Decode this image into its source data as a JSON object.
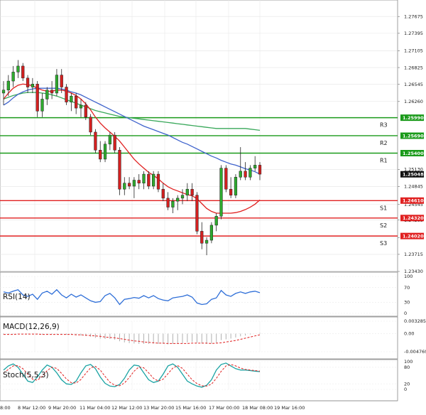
{
  "chart_data": {
    "type": "candlestick",
    "x_labels": [
      "8:00",
      "8 Mar 12:00",
      "9 Mar 20:00",
      "11 Mar 04:00",
      "12 Mar 12:00",
      "13 Mar 20:00",
      "15 Mar 16:00",
      "17 Mar 00:00",
      "18 Mar 08:00",
      "19 Mar 16:00"
    ],
    "y_ticks": [
      "1.27675",
      "1.27395",
      "1.27105",
      "1.26825",
      "1.26545",
      "1.26260",
      "1.25130",
      "1.24845",
      "1.24545",
      "1.24285",
      "1.23995",
      "1.23715",
      "1.23430"
    ],
    "ylim": [
      1.2343,
      1.27855
    ],
    "current_price": "1.25048",
    "colors": {
      "bull": "#2eaa2e",
      "bear": "#d42020",
      "ma_fast": "#e02020",
      "ma_mid": "#3f63cc",
      "ma_slow": "#39a85a",
      "resistance": "#1a9a1a",
      "support": "#e02020"
    },
    "levels": [
      {
        "name": "R3",
        "value": 1.2599,
        "label": "1.25990",
        "kind": "resistance"
      },
      {
        "name": "R2",
        "value": 1.2569,
        "label": "1.25690",
        "kind": "resistance"
      },
      {
        "name": "R1",
        "value": 1.254,
        "label": "1.25400",
        "kind": "resistance"
      },
      {
        "name": "S1",
        "value": 1.2461,
        "label": "1.24610",
        "kind": "support"
      },
      {
        "name": "S2",
        "value": 1.2432,
        "label": "1.24320",
        "kind": "support"
      },
      {
        "name": "S3",
        "value": 1.2402,
        "label": "1.24020",
        "kind": "support"
      }
    ],
    "candles": [
      [
        1.264,
        1.266,
        1.262,
        1.2645
      ],
      [
        1.2645,
        1.267,
        1.2635,
        1.266
      ],
      [
        1.266,
        1.2685,
        1.265,
        1.2675
      ],
      [
        1.2675,
        1.2695,
        1.2665,
        1.2685
      ],
      [
        1.2685,
        1.269,
        1.266,
        1.2665
      ],
      [
        1.2665,
        1.267,
        1.264,
        1.265
      ],
      [
        1.265,
        1.2665,
        1.264,
        1.2655
      ],
      [
        1.2655,
        1.266,
        1.26,
        1.261
      ],
      [
        1.261,
        1.264,
        1.26,
        1.263
      ],
      [
        1.263,
        1.265,
        1.262,
        1.2645
      ],
      [
        1.2645,
        1.266,
        1.263,
        1.264
      ],
      [
        1.264,
        1.268,
        1.2635,
        1.267
      ],
      [
        1.267,
        1.268,
        1.264,
        1.265
      ],
      [
        1.265,
        1.2655,
        1.262,
        1.2625
      ],
      [
        1.2625,
        1.264,
        1.261,
        1.2635
      ],
      [
        1.2635,
        1.264,
        1.2605,
        1.2615
      ],
      [
        1.2615,
        1.263,
        1.26,
        1.262
      ],
      [
        1.262,
        1.2625,
        1.2595,
        1.26
      ],
      [
        1.26,
        1.2605,
        1.257,
        1.2575
      ],
      [
        1.2575,
        1.258,
        1.254,
        1.2545
      ],
      [
        1.2545,
        1.256,
        1.2525,
        1.253
      ],
      [
        1.253,
        1.256,
        1.2525,
        1.2555
      ],
      [
        1.2555,
        1.2575,
        1.2545,
        1.257
      ],
      [
        1.257,
        1.2575,
        1.254,
        1.2545
      ],
      [
        1.2545,
        1.255,
        1.247,
        1.248
      ],
      [
        1.248,
        1.25,
        1.247,
        1.249
      ],
      [
        1.249,
        1.25,
        1.248,
        1.2485
      ],
      [
        1.2485,
        1.25,
        1.2465,
        1.2495
      ],
      [
        1.2495,
        1.2505,
        1.248,
        1.249
      ],
      [
        1.249,
        1.251,
        1.248,
        1.2505
      ],
      [
        1.2505,
        1.251,
        1.248,
        1.2485
      ],
      [
        1.2485,
        1.251,
        1.248,
        1.2505
      ],
      [
        1.2505,
        1.251,
        1.2475,
        1.248
      ],
      [
        1.248,
        1.249,
        1.246,
        1.2465
      ],
      [
        1.2465,
        1.2475,
        1.2445,
        1.245
      ],
      [
        1.245,
        1.2465,
        1.244,
        1.246
      ],
      [
        1.246,
        1.247,
        1.2445,
        1.2465
      ],
      [
        1.2465,
        1.248,
        1.2455,
        1.247
      ],
      [
        1.247,
        1.249,
        1.246,
        1.248
      ],
      [
        1.248,
        1.249,
        1.246,
        1.247
      ],
      [
        1.247,
        1.2475,
        1.2405,
        1.241
      ],
      [
        1.241,
        1.2425,
        1.238,
        1.239
      ],
      [
        1.239,
        1.24,
        1.237,
        1.2395
      ],
      [
        1.2395,
        1.2425,
        1.239,
        1.242
      ],
      [
        1.242,
        1.244,
        1.241,
        1.2435
      ],
      [
        1.2435,
        1.252,
        1.243,
        1.2515
      ],
      [
        1.2515,
        1.252,
        1.2475,
        1.248
      ],
      [
        1.248,
        1.25,
        1.2465,
        1.247
      ],
      [
        1.247,
        1.2505,
        1.2465,
        1.25
      ],
      [
        1.25,
        1.255,
        1.2495,
        1.251
      ],
      [
        1.251,
        1.2525,
        1.2495,
        1.25
      ],
      [
        1.25,
        1.252,
        1.2495,
        1.2515
      ],
      [
        1.2515,
        1.2535,
        1.251,
        1.252
      ],
      [
        1.252,
        1.2525,
        1.2495,
        1.2505
      ]
    ],
    "ma_fast": [
      1.263,
      1.264,
      1.2648,
      1.2653,
      1.2655,
      1.2654,
      1.2652,
      1.2648,
      1.2645,
      1.2643,
      1.2643,
      1.2645,
      1.2645,
      1.2643,
      1.264,
      1.2636,
      1.263,
      1.2622,
      1.2612,
      1.26,
      1.259,
      1.2582,
      1.2575,
      1.2568,
      1.256,
      1.255,
      1.254,
      1.253,
      1.2522,
      1.2515,
      1.2508,
      1.2503,
      1.2497,
      1.249,
      1.2484,
      1.248,
      1.2477,
      1.2474,
      1.2471,
      1.2469,
      1.2464,
      1.2456,
      1.2448,
      1.2443,
      1.244,
      1.244,
      1.244,
      1.244,
      1.2441,
      1.2443,
      1.2446,
      1.245,
      1.2455,
      1.2462
    ],
    "ma_mid": [
      1.262,
      1.2625,
      1.2632,
      1.2638,
      1.2642,
      1.2645,
      1.2647,
      1.2648,
      1.2648,
      1.2648,
      1.2648,
      1.2648,
      1.2647,
      1.2645,
      1.2642,
      1.264,
      1.2637,
      1.2633,
      1.2629,
      1.2625,
      1.2621,
      1.2617,
      1.2613,
      1.2609,
      1.2605,
      1.2601,
      1.2597,
      1.2593,
      1.2589,
      1.2585,
      1.2582,
      1.2579,
      1.2576,
      1.2573,
      1.257,
      1.2566,
      1.2562,
      1.2558,
      1.2555,
      1.2551,
      1.2547,
      1.2543,
      1.2539,
      1.2535,
      1.2532,
      1.2528,
      1.2525,
      1.2522,
      1.252,
      1.2517,
      1.2514,
      1.2512,
      1.2509,
      1.2505
    ],
    "ma_slow": [
      1.263,
      1.2633,
      1.2636,
      1.2638,
      1.264,
      1.2641,
      1.2641,
      1.2641,
      1.264,
      1.2639,
      1.2637,
      1.2635,
      1.2632,
      1.2629,
      1.2626,
      1.2623,
      1.262,
      1.2617,
      1.2614,
      1.2611,
      1.2609,
      1.2607,
      1.2605,
      1.2603,
      1.2601,
      1.26,
      1.2599,
      1.2598,
      1.2597,
      1.2596,
      1.2595,
      1.2594,
      1.2593,
      1.2592,
      1.2591,
      1.259,
      1.2589,
      1.2588,
      1.2587,
      1.2586,
      1.2585,
      1.2584,
      1.2583,
      1.2582,
      1.2581,
      1.2581,
      1.2581,
      1.2581,
      1.2581,
      1.2581,
      1.2581,
      1.258,
      1.2579,
      1.2578
    ],
    "rsi": {
      "label": "RSI(14)",
      "ticks": [
        "100",
        "70",
        "30",
        "0"
      ],
      "ylim": [
        0,
        100
      ],
      "values": [
        58,
        55,
        60,
        64,
        50,
        46,
        52,
        38,
        55,
        60,
        52,
        64,
        50,
        42,
        52,
        44,
        50,
        42,
        34,
        30,
        32,
        48,
        54,
        42,
        24,
        38,
        40,
        43,
        41,
        48,
        42,
        48,
        40,
        36,
        34,
        42,
        44,
        46,
        50,
        44,
        28,
        24,
        26,
        38,
        42,
        62,
        50,
        46,
        54,
        58,
        54,
        58,
        60,
        56
      ]
    },
    "macd": {
      "label": "MACD(12,26,9)",
      "ticks": [
        "0.003285",
        "0.00",
        "-0.004769"
      ],
      "ylim": [
        -0.004769,
        0.003285
      ],
      "hist": [
        -0.0002,
        -0.0002,
        -0.0001,
        0.0,
        0.0,
        -0.0001,
        -0.0001,
        -0.0002,
        -0.0002,
        -0.0002,
        -0.0002,
        -0.0001,
        -0.0002,
        -0.0003,
        -0.0003,
        -0.0004,
        -0.0005,
        -0.0006,
        -0.0008,
        -0.0011,
        -0.0013,
        -0.0014,
        -0.0014,
        -0.0016,
        -0.002,
        -0.0023,
        -0.0025,
        -0.0026,
        -0.0027,
        -0.0027,
        -0.0027,
        -0.0026,
        -0.0027,
        -0.0027,
        -0.0028,
        -0.0027,
        -0.0026,
        -0.0025,
        -0.0023,
        -0.0022,
        -0.0024,
        -0.0026,
        -0.0027,
        -0.0026,
        -0.0024,
        -0.0017,
        -0.0015,
        -0.0013,
        -0.001,
        -0.0007,
        -0.0005,
        -0.0002,
        0.0,
        0.0002
      ],
      "signal": [
        -0.0002,
        -0.0002,
        -0.0002,
        -0.0001,
        -0.0001,
        -0.0001,
        -0.0001,
        -0.0001,
        -0.0002,
        -0.0002,
        -0.0002,
        -0.0002,
        -0.0002,
        -0.0002,
        -0.0002,
        -0.0003,
        -0.0003,
        -0.0004,
        -0.0005,
        -0.0006,
        -0.0007,
        -0.0009,
        -0.001,
        -0.0011,
        -0.0013,
        -0.0015,
        -0.0017,
        -0.0019,
        -0.002,
        -0.0022,
        -0.0023,
        -0.0024,
        -0.0025,
        -0.0025,
        -0.0026,
        -0.0026,
        -0.0026,
        -0.0026,
        -0.0026,
        -0.0025,
        -0.0025,
        -0.0025,
        -0.0025,
        -0.0026,
        -0.0025,
        -0.0024,
        -0.0022,
        -0.002,
        -0.0018,
        -0.0015,
        -0.0012,
        -0.0009,
        -0.0006,
        -0.0003
      ]
    },
    "stoch": {
      "label": "Stoch(5,5,3)",
      "ticks": [
        "100",
        "80",
        "20",
        "0"
      ],
      "ylim": [
        0,
        100
      ],
      "k": [
        70,
        85,
        92,
        80,
        55,
        30,
        25,
        45,
        70,
        88,
        80,
        60,
        35,
        20,
        18,
        30,
        60,
        85,
        90,
        75,
        45,
        22,
        12,
        10,
        18,
        40,
        70,
        88,
        85,
        60,
        35,
        25,
        30,
        55,
        85,
        92,
        80,
        55,
        30,
        20,
        12,
        8,
        15,
        35,
        70,
        90,
        95,
        85,
        75,
        70,
        70,
        68,
        66,
        64
      ],
      "d": [
        60,
        72,
        85,
        86,
        75,
        55,
        37,
        33,
        47,
        68,
        80,
        76,
        58,
        38,
        24,
        23,
        36,
        58,
        78,
        83,
        70,
        47,
        26,
        15,
        13,
        23,
        43,
        66,
        81,
        78,
        60,
        40,
        30,
        37,
        57,
        77,
        86,
        76,
        55,
        35,
        21,
        13,
        12,
        19,
        40,
        65,
        85,
        90,
        85,
        77,
        72,
        70,
        68,
        66
      ]
    }
  }
}
